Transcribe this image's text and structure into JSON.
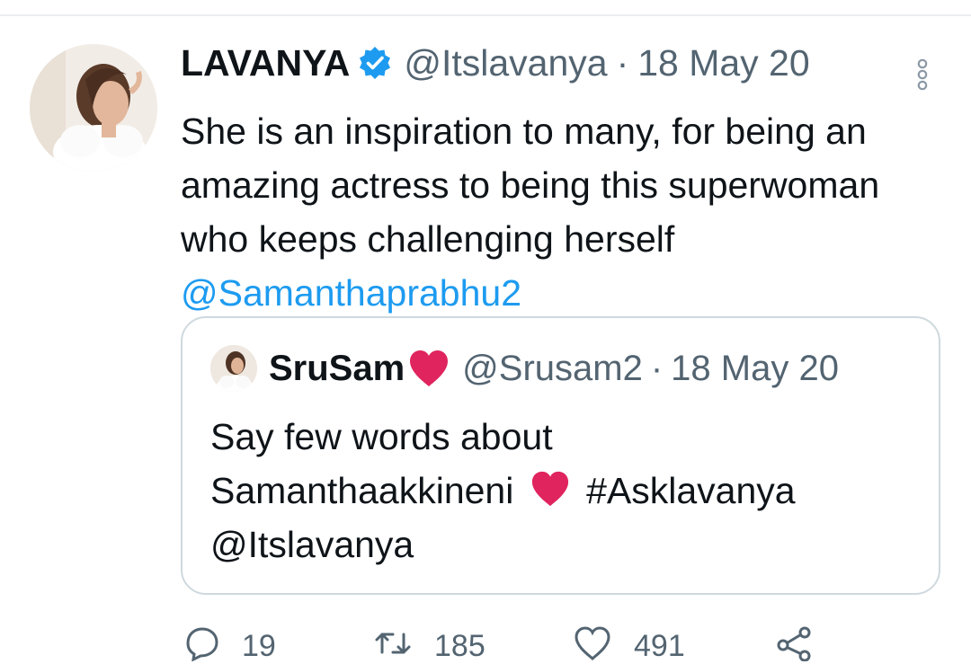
{
  "tweet": {
    "display_name": "LAVANYA",
    "verified": true,
    "handle": "@Itslavanya",
    "separator": "·",
    "date": "18 May 20",
    "text_before_mention": "She is an inspiration to many, for being an amazing actress to being this superwoman who keeps challenging herself ",
    "mention": "@Samanthaprabhu2"
  },
  "quoted_tweet": {
    "display_name": "SruSam",
    "name_emoji": "red-heart",
    "handle": "@Srusam2",
    "separator": "·",
    "date": "18 May 20",
    "text_line1": "Say few words about",
    "text_line2_start": "Samanthaakkineni ",
    "text_line2_end": " #Asklavanya",
    "text_line3": "@Itslavanya"
  },
  "actions": {
    "reply_count": "19",
    "retweet_count": "185",
    "like_count": "491"
  },
  "colors": {
    "text_primary": "#0f1419",
    "text_secondary": "#536471",
    "link": "#1d9bf0",
    "heart": "#e0245e",
    "border": "#cfd9de"
  },
  "icons": [
    "verified-badge-icon",
    "more-options-icon",
    "red-heart-icon",
    "reply-icon",
    "retweet-icon",
    "like-icon",
    "share-icon"
  ]
}
